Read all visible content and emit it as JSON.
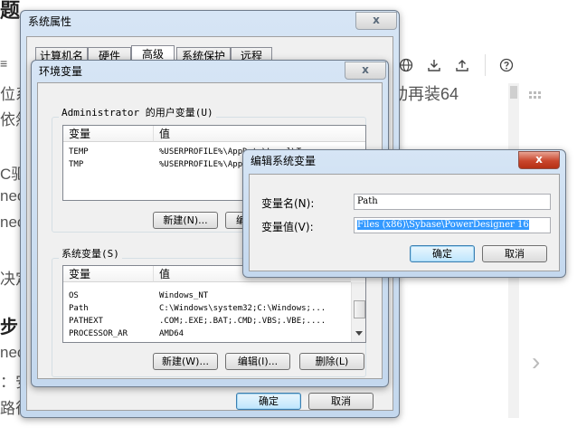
{
  "background": {
    "title_fragment": "题",
    "lines": [
      "位系",
      "依然",
      "C驱",
      "nec",
      "nec",
      "决定",
      "步",
      "nec",
      "：安",
      "路径"
    ],
    "right_text": "动再装64",
    "toolbar_icons": [
      "globe-icon",
      "download-icon",
      "upload-icon",
      "help-icon"
    ],
    "menu_icon": "≡",
    "paren_fragment": ")",
    "arrow_glyph": "›"
  },
  "system_properties": {
    "title": "系统属性",
    "close": "x",
    "tabs": [
      "计算机名",
      "硬件",
      "高级",
      "系统保护",
      "远程"
    ],
    "active_tab": "高级",
    "ok": "确定",
    "cancel": "取消"
  },
  "env_vars": {
    "title": "环境变量",
    "close": "x",
    "user_group_label": "Administrator 的用户变量(U)",
    "user_headers": [
      "变量",
      "值"
    ],
    "user_rows": [
      {
        "name": "TEMP",
        "value": "%USERPROFILE%\\AppData\\Local\\Temp"
      },
      {
        "name": "TMP",
        "value": "%USERPROFILE%\\AppData\\Local\\Temp"
      }
    ],
    "user_new": "新建(N)...",
    "user_edit": "编辑(E)...",
    "system_group_label": "系统变量(S)",
    "system_headers": [
      "变量",
      "值"
    ],
    "system_rows": [
      {
        "name": "OS",
        "value": "Windows_NT"
      },
      {
        "name": "Path",
        "value": "C:\\Windows\\system32;C:\\Windows;..."
      },
      {
        "name": "PATHEXT",
        "value": ".COM;.EXE;.BAT;.CMD;.VBS;.VBE;...."
      },
      {
        "name": "PROCESSOR_AR",
        "value": "AMD64"
      }
    ],
    "sys_new": "新建(W)...",
    "sys_edit": "编辑(I)...",
    "sys_delete": "删除(L)",
    "ok": "确定",
    "cancel": "取消"
  },
  "edit_var": {
    "title": "编辑系统变量",
    "close": "x",
    "name_label": "变量名(N):",
    "name_value": "Path",
    "value_label": "变量值(V):",
    "value_value": "Files (x86)\\Sybase\\PowerDesigner 16",
    "ok": "确定",
    "cancel": "取消"
  },
  "colors": {
    "selection": "#3399ff",
    "aero_frame": "#c4d8ee"
  }
}
